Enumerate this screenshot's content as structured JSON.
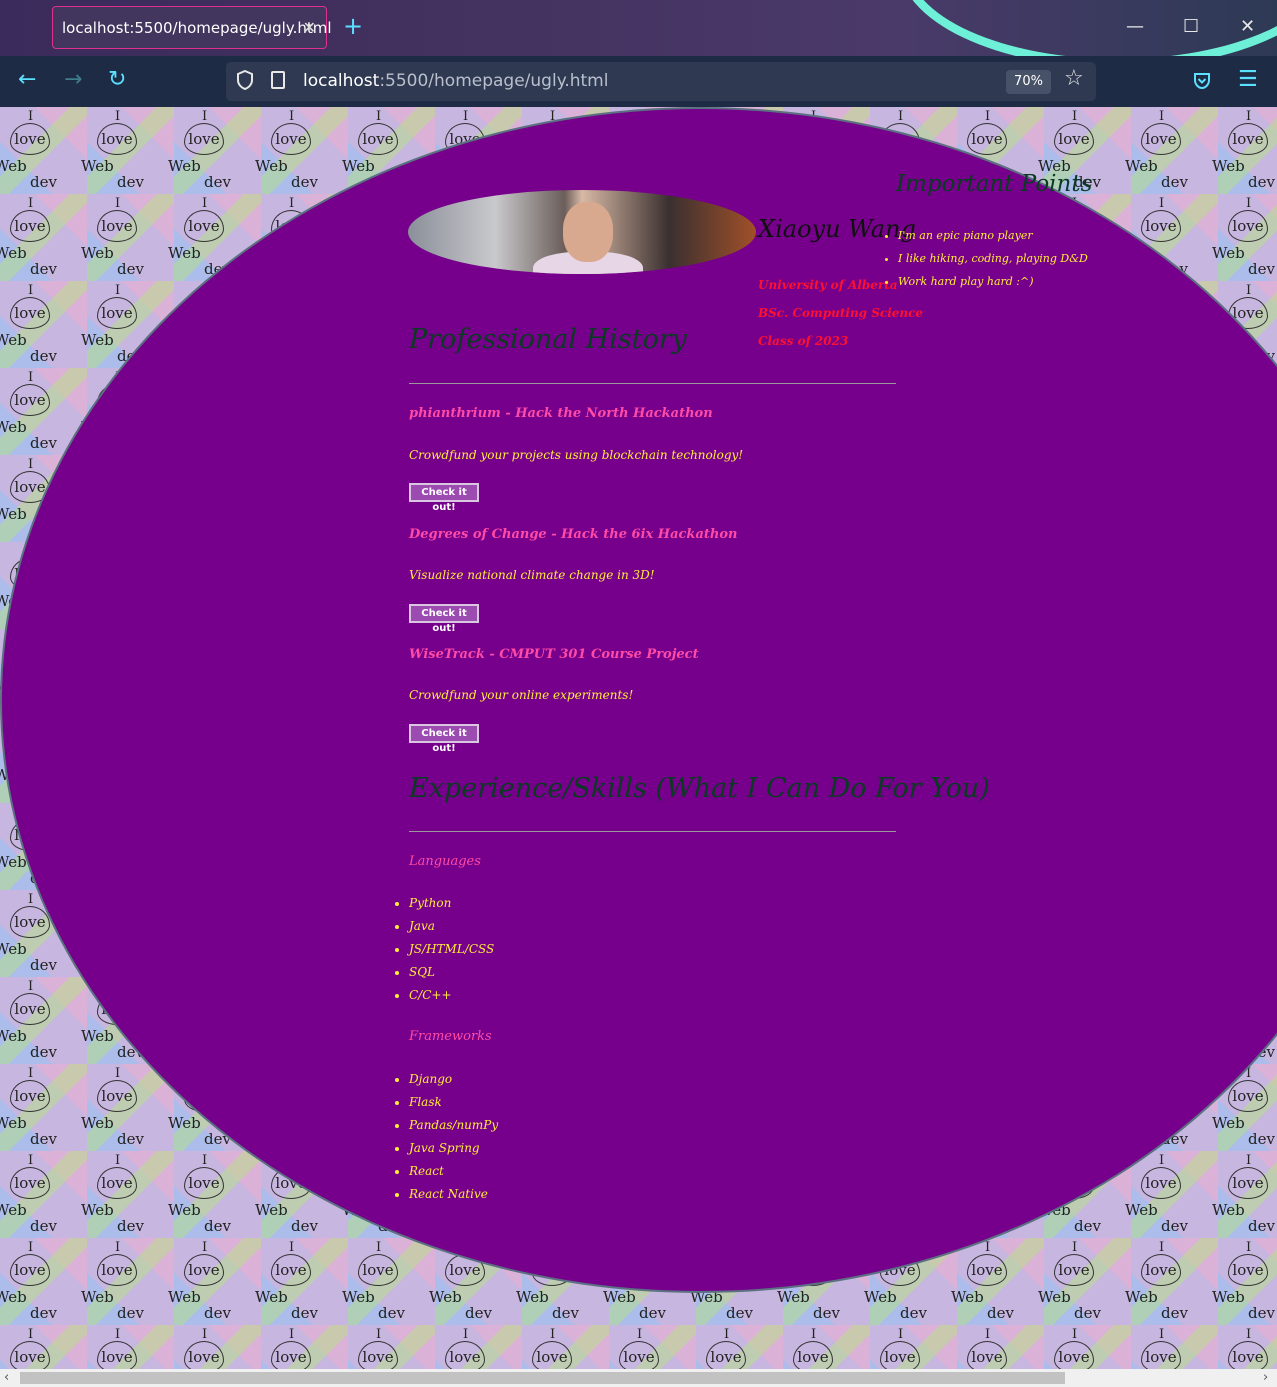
{
  "browser": {
    "tab_title": "localhost:5500/homepage/ugly.html",
    "tab_close": "✕",
    "new_tab": "+",
    "window_controls": {
      "minimize": "—",
      "maximize": "☐",
      "close": "✕"
    },
    "nav": {
      "back": "←",
      "forward": "→",
      "reload": "↻"
    },
    "url_host": "localhost",
    "url_path": ":5500/homepage/ugly.html",
    "zoom": "70%",
    "bookmark_icon": "☆",
    "pocket_icon": "pocket-icon",
    "menu_icon": "☰",
    "accent_color": "#5ce0ff"
  },
  "background_tile": {
    "line1": "I",
    "line2": "love",
    "line3": "Web",
    "line4": "dev"
  },
  "profile": {
    "name": "Xiaoyu Wang",
    "university": "University of Alberta",
    "degree": "BSc. Computing Science",
    "class_of": "Class of 2023"
  },
  "important": {
    "title": "Important Points",
    "items": [
      "I'm an epic piano player",
      "I like hiking, coding, playing D&D",
      "Work hard play hard :^)"
    ]
  },
  "professional": {
    "heading": "Professional History",
    "projects": [
      {
        "title": "phianthrium - Hack the North Hackathon",
        "desc": "Crowdfund your projects using blockchain technology!",
        "button": "Check it out!"
      },
      {
        "title": "Degrees of Change - Hack the 6ix Hackathon",
        "desc": "Visualize national climate change in 3D!",
        "button": "Check it out!"
      },
      {
        "title": "WiseTrack - CMPUT 301 Course Project",
        "desc": "Crowdfund your online experiments!",
        "button": "Check it out!"
      }
    ]
  },
  "skills": {
    "heading": "Experience/Skills (What I Can Do For You)",
    "languages_title": "Languages",
    "languages": [
      "Python",
      "Java",
      "JS/HTML/CSS",
      "SQL",
      "C/C++"
    ],
    "frameworks_title": "Frameworks",
    "frameworks": [
      "Django",
      "Flask",
      "Pandas/numPy",
      "Java Spring",
      "React",
      "React Native"
    ]
  },
  "colors": {
    "blob": "#76008c",
    "list_text": "#ffeb3b",
    "accent_pink": "#ff4aa6",
    "uni_red": "#ff1030"
  }
}
